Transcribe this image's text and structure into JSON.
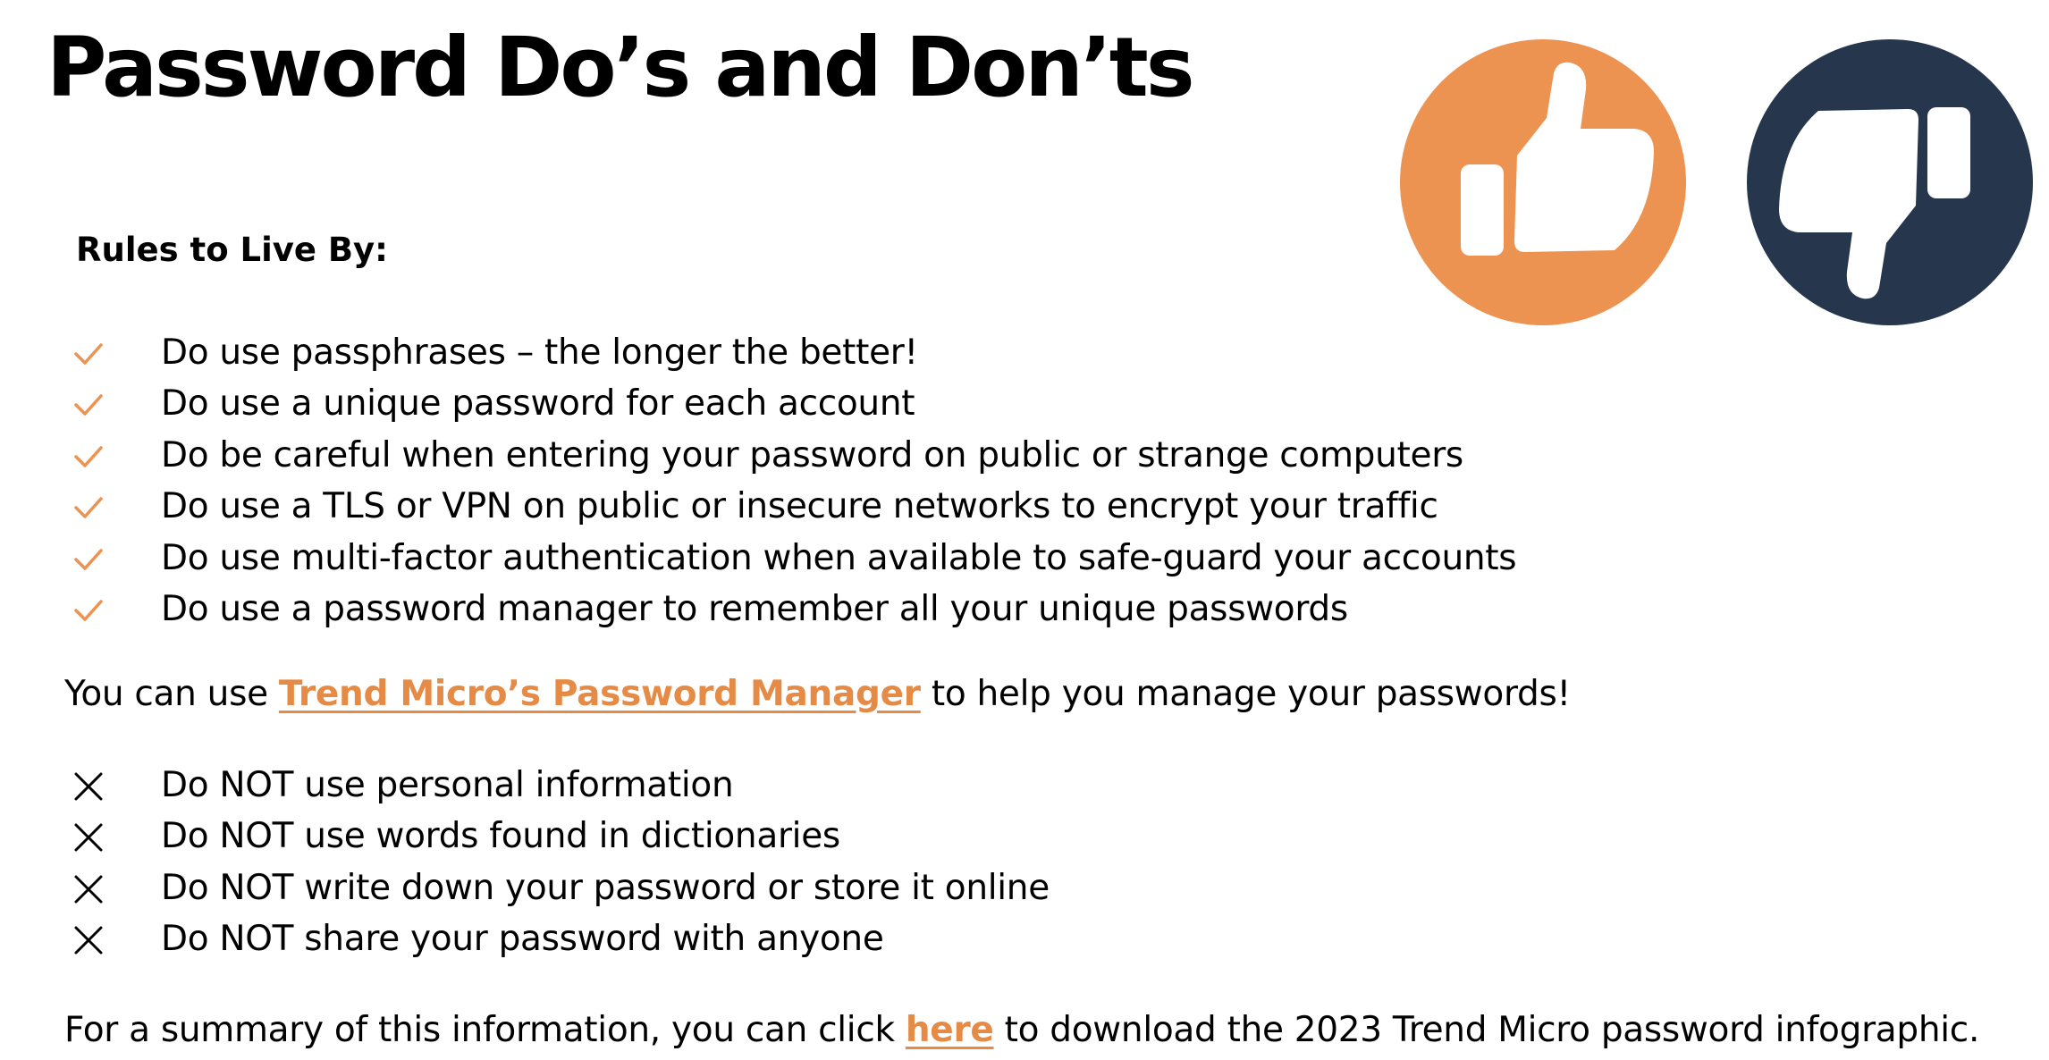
{
  "title": "Password Do’s and Don’ts",
  "icons": {
    "thumbs_up": {
      "name": "thumbs-up-icon",
      "color": "#ec9352",
      "glyph_color": "#ffffff"
    },
    "thumbs_down": {
      "name": "thumbs-down-icon",
      "color": "#26364d",
      "glyph_color": "#ffffff"
    }
  },
  "rules_heading": "Rules to Live By:",
  "colors": {
    "accent": "#e58b45",
    "check": "#ec9352",
    "cross": "#000000"
  },
  "dos": [
    {
      "icon": "checkmark-icon",
      "text": "Do use passphrases – the longer the better!"
    },
    {
      "icon": "checkmark-icon",
      "text": "Do use a unique password for each account"
    },
    {
      "icon": "checkmark-icon",
      "text": "Do be careful when entering your password on public or strange computers"
    },
    {
      "icon": "checkmark-icon",
      "text": "Do use a TLS or VPN on public or insecure networks to encrypt your traffic"
    },
    {
      "icon": "checkmark-icon",
      "text": "Do use multi-factor authentication when available to safe-guard your accounts"
    },
    {
      "icon": "checkmark-icon",
      "text": "Do use a password manager to remember all your unique passwords"
    }
  ],
  "manager_note": {
    "before": "You can use ",
    "link_text": "Trend Micro’s Password Manager",
    "after": " to help you manage your passwords!"
  },
  "donts": [
    {
      "icon": "cross-icon",
      "text": "Do NOT use personal information"
    },
    {
      "icon": "cross-icon",
      "text": "Do NOT use words found in dictionaries"
    },
    {
      "icon": "cross-icon",
      "text": "Do NOT write down your password or store it online"
    },
    {
      "icon": "cross-icon",
      "text": "Do NOT share your password with anyone"
    }
  ],
  "summary_note": {
    "before": "For a summary of this information, you can click ",
    "link_text": "here",
    "after": " to download the 2023 Trend Micro password infographic."
  }
}
